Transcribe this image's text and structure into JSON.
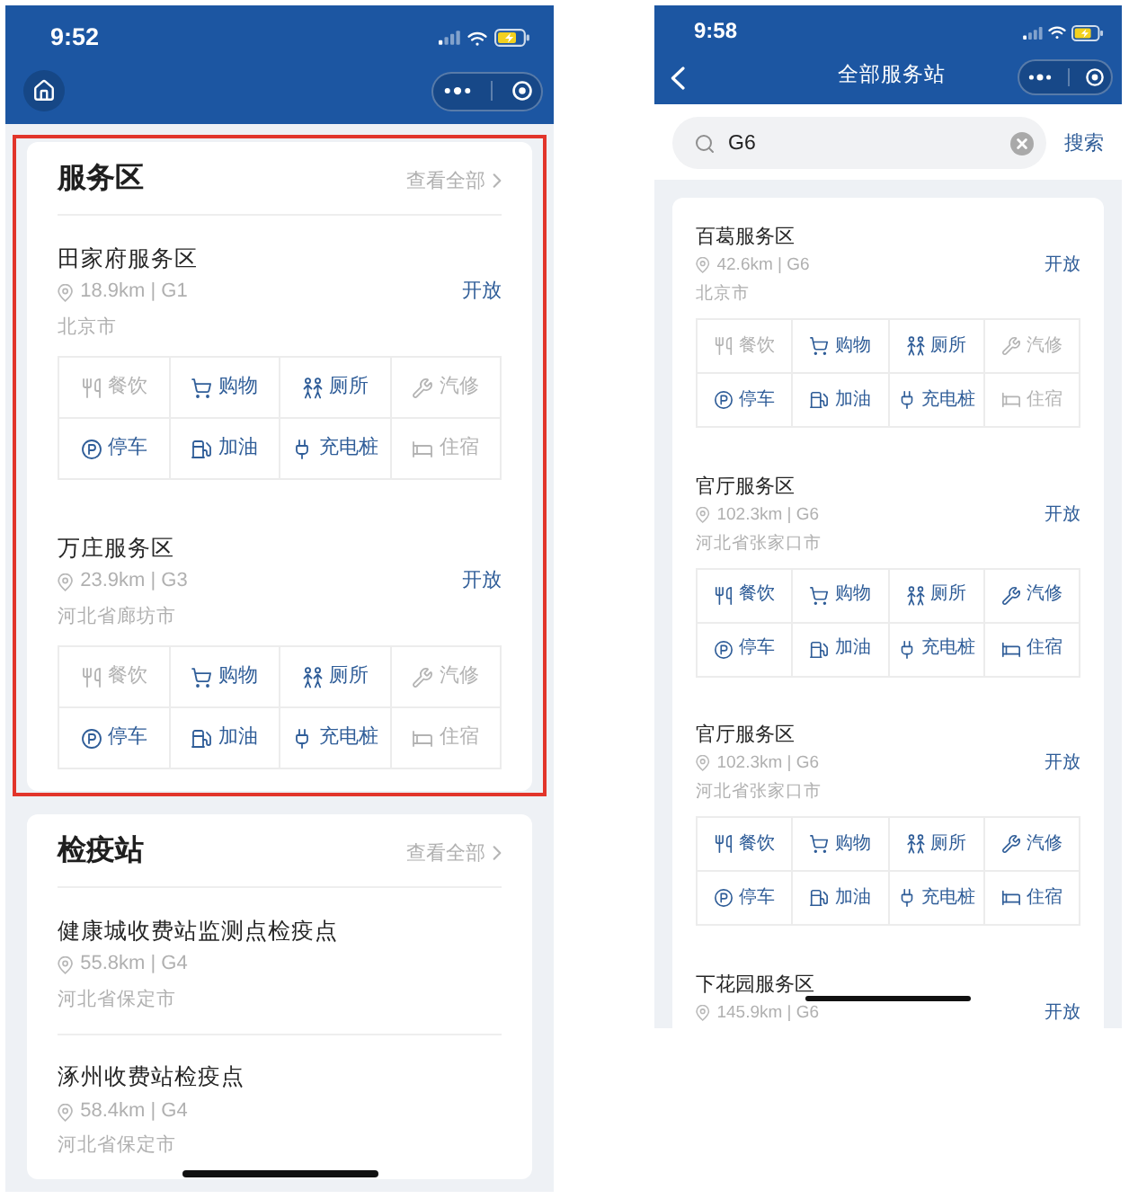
{
  "screens": [
    {
      "kind": "home",
      "status_bar": {
        "time": "9:52"
      },
      "sections": [
        {
          "title": "服务区",
          "view_all": "查看全部",
          "highlighted": true,
          "items": [
            {
              "name": "田家府服务区",
              "distance": "18.9km | G1",
              "status": "开放",
              "city": "北京市",
              "facilities": [
                {
                  "label": "餐饮",
                  "available": false
                },
                {
                  "label": "购物",
                  "available": true
                },
                {
                  "label": "厕所",
                  "available": true
                },
                {
                  "label": "汽修",
                  "available": false
                },
                {
                  "label": "停车",
                  "available": true
                },
                {
                  "label": "加油",
                  "available": true
                },
                {
                  "label": "充电桩",
                  "available": true
                },
                {
                  "label": "住宿",
                  "available": false
                }
              ]
            },
            {
              "name": "万庄服务区",
              "distance": "23.9km | G3",
              "status": "开放",
              "city": "河北省廊坊市",
              "facilities": [
                {
                  "label": "餐饮",
                  "available": false
                },
                {
                  "label": "购物",
                  "available": true
                },
                {
                  "label": "厕所",
                  "available": true
                },
                {
                  "label": "汽修",
                  "available": false
                },
                {
                  "label": "停车",
                  "available": true
                },
                {
                  "label": "加油",
                  "available": true
                },
                {
                  "label": "充电桩",
                  "available": true
                },
                {
                  "label": "住宿",
                  "available": false
                }
              ]
            }
          ]
        },
        {
          "title": "检疫站",
          "view_all": "查看全部",
          "highlighted": false,
          "items": [
            {
              "name": "健康城收费站监测点检疫点",
              "distance": "55.8km | G4",
              "city": "河北省保定市"
            },
            {
              "name": "涿州收费站检疫点",
              "distance": "58.4km | G4",
              "city": "河北省保定市"
            }
          ]
        }
      ]
    },
    {
      "kind": "search",
      "status_bar": {
        "time": "9:58"
      },
      "title": "全部服务站",
      "search": {
        "value": "G6",
        "button": "搜索"
      },
      "items": [
        {
          "name": "百葛服务区",
          "distance": "42.6km | G6",
          "status": "开放",
          "city": "北京市",
          "facilities": [
            {
              "label": "餐饮",
              "available": false
            },
            {
              "label": "购物",
              "available": true
            },
            {
              "label": "厕所",
              "available": true
            },
            {
              "label": "汽修",
              "available": false
            },
            {
              "label": "停车",
              "available": true
            },
            {
              "label": "加油",
              "available": true
            },
            {
              "label": "充电桩",
              "available": true
            },
            {
              "label": "住宿",
              "available": false
            }
          ]
        },
        {
          "name": "官厅服务区",
          "distance": "102.3km | G6",
          "status": "开放",
          "city": "河北省张家口市",
          "facilities": [
            {
              "label": "餐饮",
              "available": true
            },
            {
              "label": "购物",
              "available": true
            },
            {
              "label": "厕所",
              "available": true
            },
            {
              "label": "汽修",
              "available": true
            },
            {
              "label": "停车",
              "available": true
            },
            {
              "label": "加油",
              "available": true
            },
            {
              "label": "充电桩",
              "available": true
            },
            {
              "label": "住宿",
              "available": true
            }
          ]
        },
        {
          "name": "官厅服务区",
          "distance": "102.3km | G6",
          "status": "开放",
          "city": "河北省张家口市",
          "facilities": [
            {
              "label": "餐饮",
              "available": true
            },
            {
              "label": "购物",
              "available": true
            },
            {
              "label": "厕所",
              "available": true
            },
            {
              "label": "汽修",
              "available": true
            },
            {
              "label": "停车",
              "available": true
            },
            {
              "label": "加油",
              "available": true
            },
            {
              "label": "充电桩",
              "available": true
            },
            {
              "label": "住宿",
              "available": true
            }
          ]
        },
        {
          "name": "下花园服务区",
          "distance": "145.9km | G6",
          "status": "开放"
        }
      ]
    }
  ]
}
